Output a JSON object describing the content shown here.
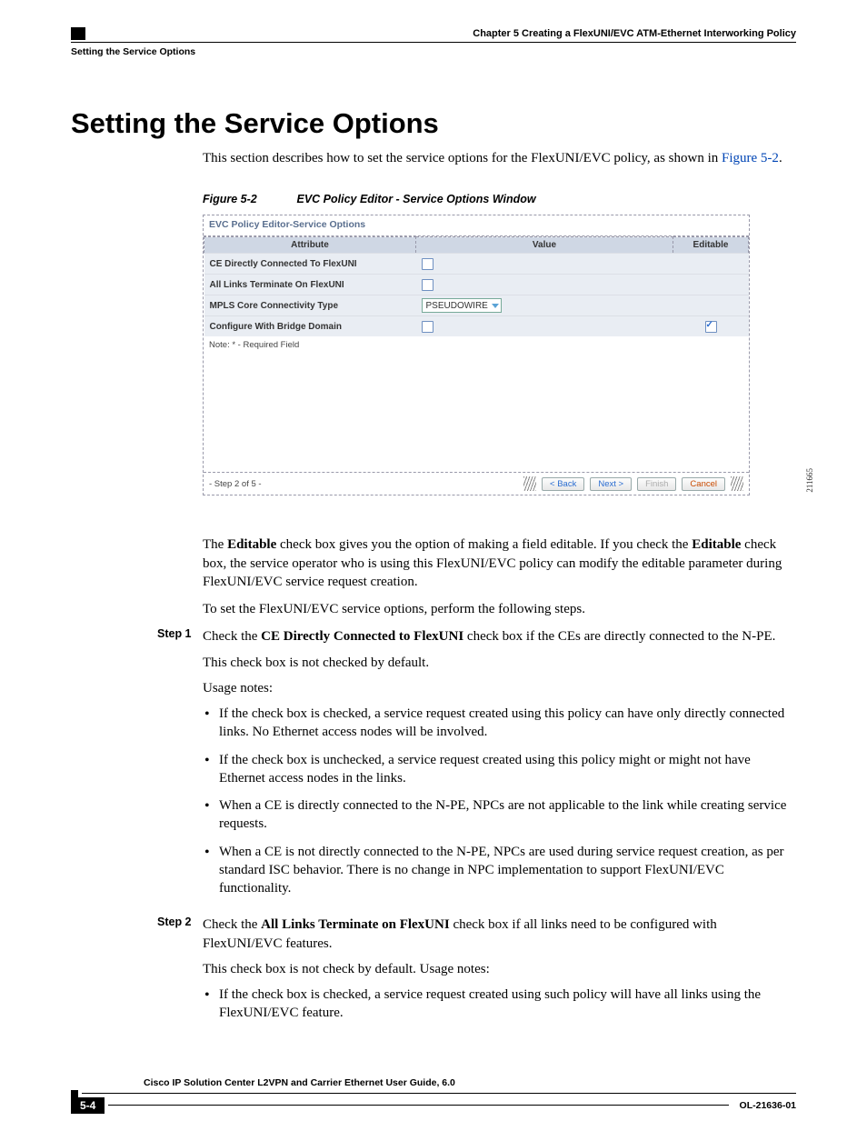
{
  "header": {
    "chapter": "Chapter 5      Creating a FlexUNI/EVC ATM-Ethernet Interworking Policy",
    "section_running": "Setting the Service Options"
  },
  "title": "Setting the Service Options",
  "intro": "This section describes how to set the service options for the FlexUNI/EVC policy, as shown in ",
  "intro_link": "Figure 5-2",
  "figure": {
    "label": "Figure 5-2",
    "caption": "EVC Policy Editor - Service Options Window",
    "window_title": "EVC Policy Editor-Service Options",
    "col_attr": "Attribute",
    "col_value": "Value",
    "col_editable": "Editable",
    "rows": {
      "r1": "CE Directly Connected To FlexUNI",
      "r2": "All Links Terminate On FlexUNI",
      "r3": "MPLS Core Connectivity Type",
      "r3_val": "PSEUDOWIRE",
      "r4": "Configure With Bridge Domain"
    },
    "note": "Note: * - Required Field",
    "step_indicator": "- Step 2 of 5 -",
    "btn_back": "< Back",
    "btn_next": "Next >",
    "btn_finish": "Finish",
    "btn_cancel": "Cancel",
    "img_id": "211665"
  },
  "para_editable_1": "The ",
  "para_editable_b1": "Editable",
  "para_editable_2": " check box gives you the option of making a field editable. If you check the ",
  "para_editable_b2": "Editable",
  "para_editable_3": " check box, the service operator who is using this FlexUNI/EVC policy can modify the editable parameter during FlexUNI/EVC service request creation.",
  "para_toset": "To set the FlexUNI/EVC service options, perform the following steps.",
  "step1": {
    "label": "Step 1",
    "lead_a": "Check the ",
    "lead_b": "CE Directly Connected to FlexUNI",
    "lead_c": " check box if the CEs are directly connected to the N-PE.",
    "p1": "This check box is not checked by default.",
    "p2": "Usage notes:",
    "bul1": "If the check box is checked, a service request created using this policy can have only directly connected links. No Ethernet access nodes will be involved.",
    "bul2": "If the check box is unchecked, a service request created using this policy might or might not have Ethernet access nodes in the links.",
    "bul3": "When a CE is directly connected to the N-PE, NPCs are not applicable to the link while creating service requests.",
    "bul4": "When a CE is not directly connected to the N-PE, NPCs are used during service request creation, as per standard ISC behavior. There is no change in NPC implementation to support FlexUNI/EVC functionality."
  },
  "step2": {
    "label": "Step 2",
    "lead_a": "Check the ",
    "lead_b": "All Links Terminate on FlexUNI",
    "lead_c": " check box if all links need to be configured with FlexUNI/EVC features.",
    "p1": "This check box is not check by default. Usage notes:",
    "bul1": "If the check box is checked, a service request created using such policy will have all links using the FlexUNI/EVC feature."
  },
  "footer": {
    "book": "Cisco IP Solution Center L2VPN and Carrier Ethernet User Guide, 6.0",
    "page": "5-4",
    "docid": "OL-21636-01"
  }
}
